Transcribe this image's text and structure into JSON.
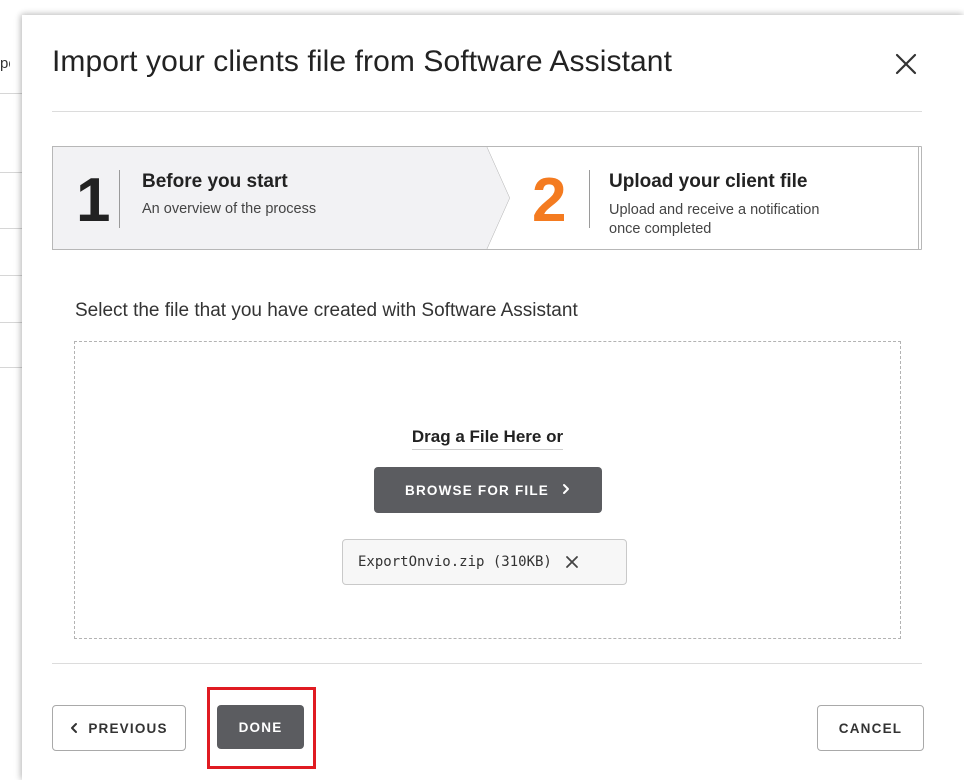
{
  "background": {
    "partial_text": "po"
  },
  "dialog": {
    "title": "Import your clients file from Software Assistant",
    "close_icon": "close-icon"
  },
  "stepper": {
    "steps": [
      {
        "number": "1",
        "title": "Before you start",
        "description": "An overview of the process",
        "number_color": "#222222",
        "state": "completed"
      },
      {
        "number": "2",
        "title": "Upload your client file",
        "description_line1": "Upload and receive a notification",
        "description_line2": "once completed",
        "number_color": "#f47b20",
        "state": "active"
      }
    ]
  },
  "upload": {
    "instruction": "Select the file that you have created with Software Assistant",
    "drag_text": "Drag a File Here or",
    "browse_label": "BROWSE FOR FILE",
    "browse_icon": "chevron-right-icon",
    "file": {
      "name": "ExportOnvio.zip (310KB)",
      "remove_icon": "remove-icon"
    }
  },
  "footer": {
    "previous_label": "PREVIOUS",
    "previous_icon": "chevron-left-icon",
    "done_label": "DONE",
    "cancel_label": "CANCEL"
  },
  "colors": {
    "accent_orange": "#f47b20",
    "button_dark": "#5b5c60",
    "highlight_red": "#e01b22"
  }
}
